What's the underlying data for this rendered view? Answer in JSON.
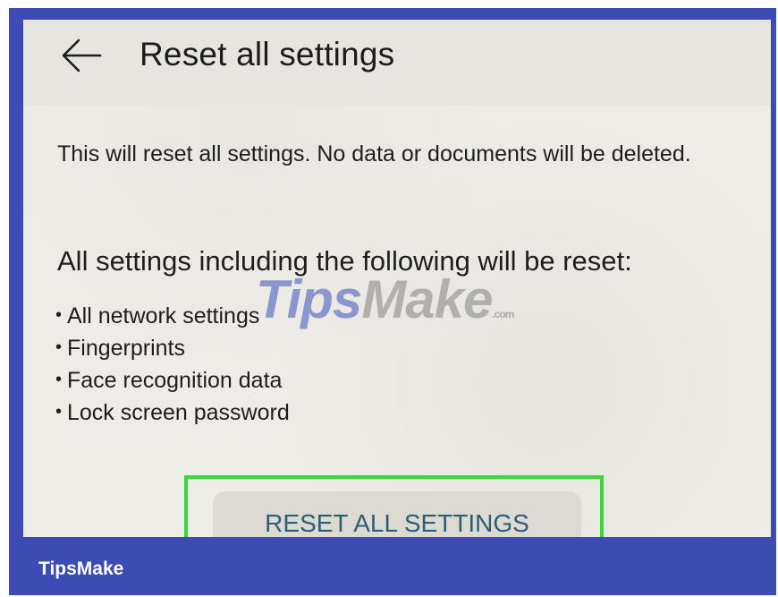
{
  "header": {
    "title": "Reset all settings",
    "back_icon": "arrow-left-icon"
  },
  "content": {
    "description": "This will reset all settings. No data or documents will be deleted.",
    "subheading": "All settings including the following will be reset:",
    "items": [
      "All network settings",
      "Fingerprints",
      "Face recognition data",
      "Lock screen password"
    ],
    "button_label": "RESET ALL SETTINGS"
  },
  "watermark": {
    "tips": "Tips",
    "make": "Make",
    "com": ".com"
  },
  "footer": {
    "brand": "TipsMake"
  },
  "colors": {
    "frame": "#3c4cb4",
    "highlight": "#3bd63e",
    "button_text": "#2d5e73"
  }
}
